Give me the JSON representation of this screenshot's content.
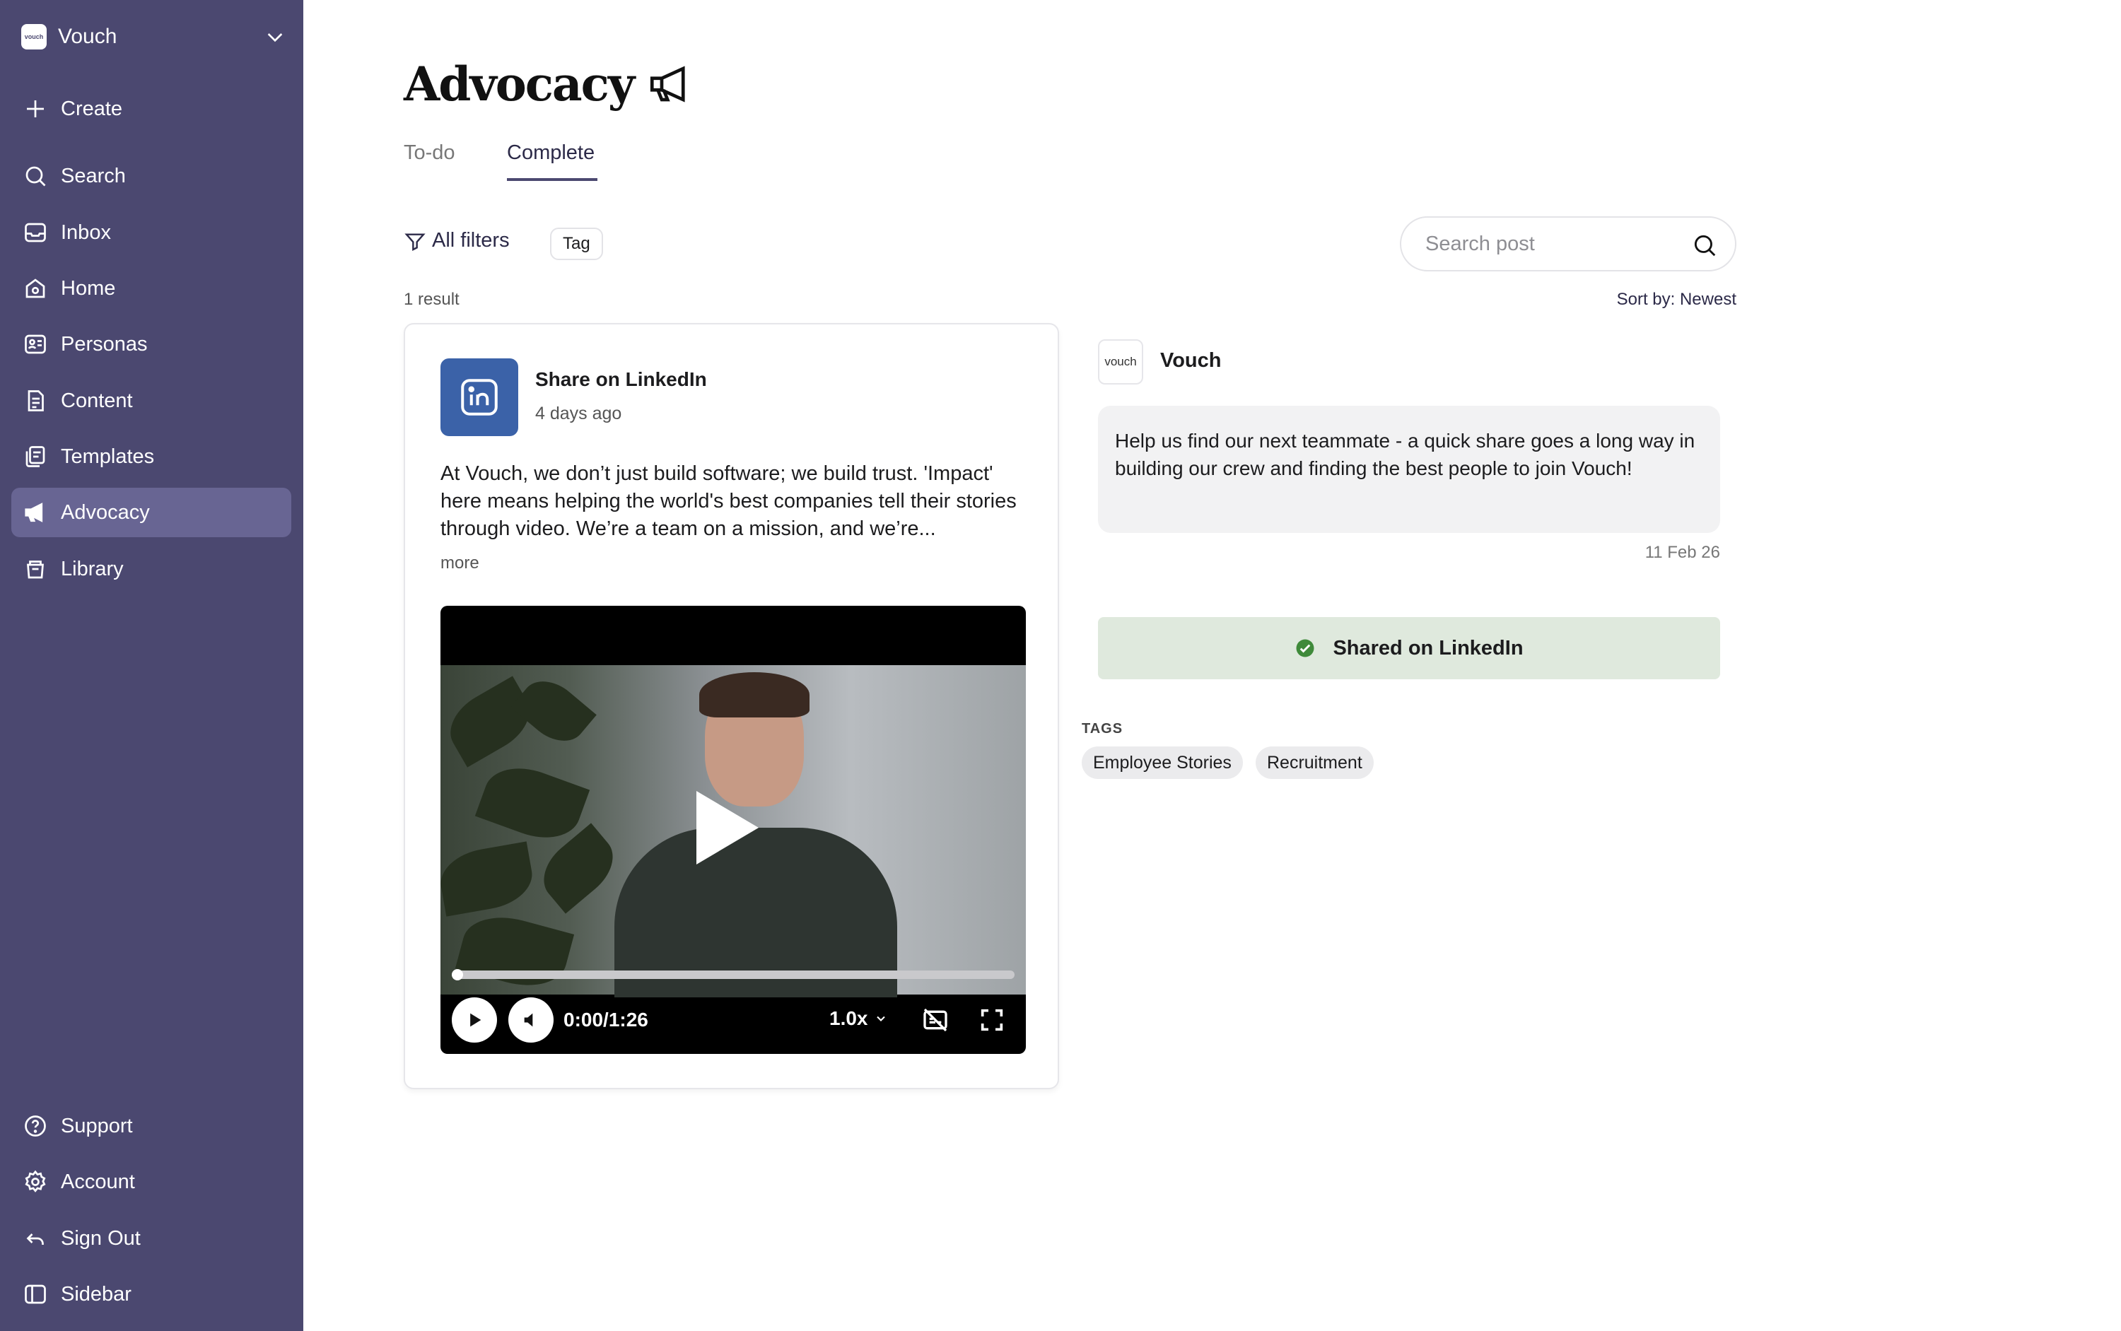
{
  "sidebar": {
    "workspace": {
      "logo_text": "vouch",
      "name": "Vouch"
    },
    "nav": [
      {
        "label": "Create",
        "icon": "plus-icon"
      },
      {
        "label": "Search",
        "icon": "search-icon"
      },
      {
        "label": "Inbox",
        "icon": "inbox-icon"
      },
      {
        "label": "Home",
        "icon": "home-icon"
      },
      {
        "label": "Personas",
        "icon": "id-card-icon"
      },
      {
        "label": "Content",
        "icon": "document-icon"
      },
      {
        "label": "Templates",
        "icon": "templates-icon"
      },
      {
        "label": "Advocacy",
        "icon": "megaphone-icon",
        "active": true
      },
      {
        "label": "Library",
        "icon": "library-icon"
      }
    ],
    "footer": [
      {
        "label": "Support",
        "icon": "help-icon"
      },
      {
        "label": "Account",
        "icon": "gear-icon"
      },
      {
        "label": "Sign Out",
        "icon": "sign-out-icon"
      },
      {
        "label": "Sidebar",
        "icon": "sidebar-toggle-icon"
      }
    ]
  },
  "page": {
    "title": "Advocacy",
    "tabs": [
      {
        "label": "To-do",
        "active": false
      },
      {
        "label": "Complete",
        "active": true
      }
    ],
    "filters": {
      "all_filters_label": "All filters",
      "tag_label": "Tag"
    },
    "search": {
      "placeholder": "Search post"
    },
    "result_count": "1 result",
    "sort_label": "Sort by: Newest"
  },
  "post": {
    "platform_title": "Share on LinkedIn",
    "time_ago": "4 days ago",
    "text": "At Vouch, we don’t just build software; we build trust. 'Impact' here means helping the world's best companies tell their stories through video. We’re a team on a mission, and we’re...",
    "more_label": "more",
    "video": {
      "time": "0:00/1:26",
      "speed": "1.0x",
      "progress": 0
    }
  },
  "detail": {
    "author_logo_text": "vouch",
    "author": "Vouch",
    "message": "Help us find our next teammate - a quick share goes a long way in building our crew and finding the best people to join Vouch!",
    "date": "11 Feb 26",
    "shared_status": "Shared on LinkedIn",
    "tags_label": "TAGS",
    "tags": [
      "Employee Stories",
      "Recruitment"
    ]
  },
  "colors": {
    "sidebar_bg": "#4b4870",
    "sidebar_active": "#686593",
    "linkedin_blue": "#3b62a8",
    "shared_bg": "#dfe9dd",
    "success_green": "#3f8a3a"
  }
}
